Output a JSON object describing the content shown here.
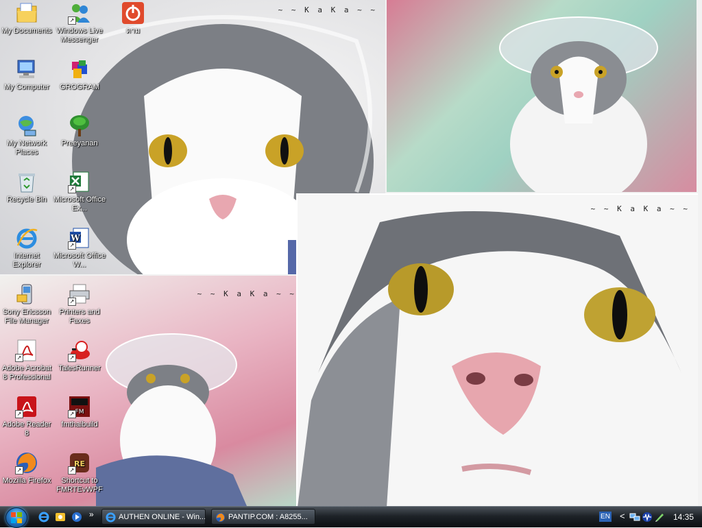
{
  "wallpaper": {
    "watermark_top_left": "~ ~  K a K a ~ ~",
    "watermark_bottom_right": "~ ~  K a K a ~ ~",
    "watermark_bottom_left": "~ ~  K a K a ~ ~"
  },
  "desktop_icons": [
    {
      "label": "My Documents",
      "icon": "my-documents-icon",
      "shortcut": false
    },
    {
      "label": "Windows Live Messenger",
      "icon": "messenger-icon",
      "shortcut": true
    },
    {
      "label": "ตาม",
      "icon": "power-icon",
      "shortcut": false
    },
    {
      "label": "My Computer",
      "icon": "my-computer-icon",
      "shortcut": false
    },
    {
      "label": "GROGRAM",
      "icon": "grogram-icon",
      "shortcut": false
    },
    {
      "label": "My Network Places",
      "icon": "network-places-icon",
      "shortcut": false
    },
    {
      "label": "Preeyanan",
      "icon": "tree-icon",
      "shortcut": false
    },
    {
      "label": "Recycle Bin",
      "icon": "recycle-bin-icon",
      "shortcut": false
    },
    {
      "label": "Microsoft Office Ex...",
      "icon": "excel-icon",
      "shortcut": true
    },
    {
      "label": "Internet Explorer",
      "icon": "internet-explorer-icon",
      "shortcut": false
    },
    {
      "label": "Microsoft Office W...",
      "icon": "word-icon",
      "shortcut": true
    },
    {
      "label": "Sony Ericsson File Manager",
      "icon": "phone-icon",
      "shortcut": false
    },
    {
      "label": "Printers and Faxes",
      "icon": "printer-icon",
      "shortcut": true
    },
    {
      "label": "Adobe Acrobat 8 Professional",
      "icon": "acrobat-icon",
      "shortcut": true
    },
    {
      "label": "TalesRunner",
      "icon": "talesrunner-icon",
      "shortcut": true
    },
    {
      "label": "Adobe Reader 8",
      "icon": "adobe-reader-icon",
      "shortcut": true
    },
    {
      "label": "fmthaibuild",
      "icon": "fmthaibuild-icon",
      "shortcut": true
    },
    {
      "label": "Mozilla Firefox",
      "icon": "firefox-icon",
      "shortcut": true
    },
    {
      "label": "Shortcut to FMRTEvWPF",
      "icon": "fmrte-icon",
      "shortcut": true
    }
  ],
  "taskbar": {
    "start_icon": "windows-start-icon",
    "quick_launch_more": "»",
    "tasks": [
      {
        "label": "AUTHEN ONLINE - Win...",
        "icon": "internet-explorer-icon"
      },
      {
        "label": "PANTIP.COM : A8255...",
        "icon": "firefox-icon"
      }
    ],
    "tray": {
      "language": "EN",
      "expand": "<",
      "clock": "14:35"
    }
  },
  "colors": {
    "taskbar_dark": "#0b0e11",
    "start_orb": "#2a7cc8",
    "lang_badge": "#2b63b5"
  }
}
